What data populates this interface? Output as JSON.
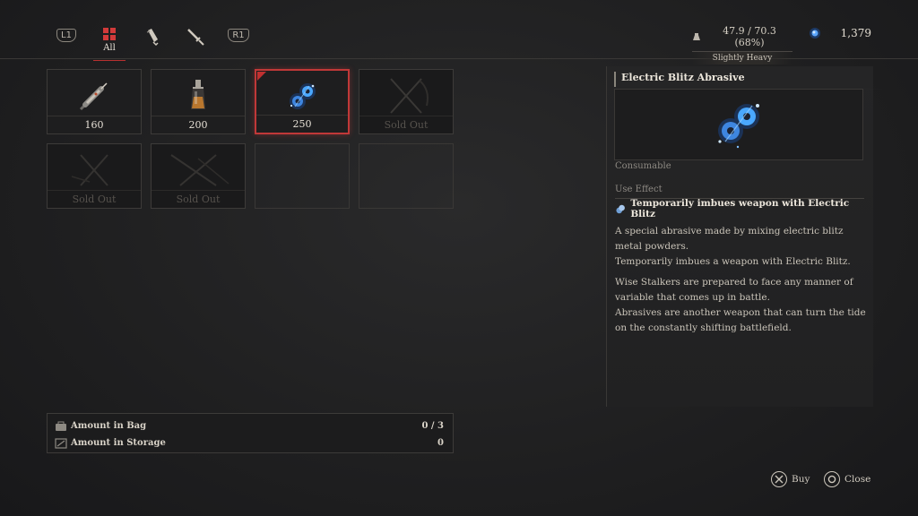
{
  "tabs": [
    {
      "kind": "shoulder",
      "label": "L1"
    },
    {
      "kind": "grid-icon",
      "label": "All",
      "active": true
    },
    {
      "kind": "consumable-icon",
      "label": ""
    },
    {
      "kind": "weapon-icon",
      "label": ""
    },
    {
      "kind": "shoulder",
      "label": "R1"
    }
  ],
  "weight": {
    "value": "47.9 / 70.3 (68%)",
    "status": "Slightly Heavy"
  },
  "currency": {
    "amount": "1,379"
  },
  "items": [
    {
      "price": "160",
      "sold_out": false,
      "selected": false,
      "icon": "syringe-icon"
    },
    {
      "price": "200",
      "sold_out": false,
      "selected": false,
      "icon": "flask-icon"
    },
    {
      "price": "250",
      "sold_out": false,
      "selected": true,
      "icon": "electric-blitz-abrasive-icon"
    },
    {
      "price": "Sold Out",
      "sold_out": true,
      "selected": false,
      "icon": "crossed-blades-icon"
    },
    {
      "price": "Sold Out",
      "sold_out": true,
      "selected": false,
      "icon": "crossed-blades-icon"
    },
    {
      "price": "Sold Out",
      "sold_out": true,
      "selected": false,
      "icon": "crossed-blades-icon"
    }
  ],
  "amounts": {
    "bag_label": "Amount in Bag",
    "bag_value": "0 / 3",
    "storage_label": "Amount in Storage",
    "storage_value": "0"
  },
  "detail": {
    "title": "Electric Blitz Abrasive",
    "category": "Consumable",
    "use_effect_label": "Use Effect",
    "effect": "Temporarily imbues weapon with Electric Blitz",
    "desc1": "A special abrasive made by mixing electric blitz metal powders.",
    "desc2": "Temporarily imbues a weapon with Electric Blitz.",
    "desc3": "Wise Stalkers are prepared to face any manner of variable that comes up in battle.",
    "desc4": "Abrasives are another weapon that can turn the tide on the constantly shifting battlefield."
  },
  "footer": {
    "buy_label": "Buy",
    "close_label": "Close"
  },
  "colors": {
    "accent_red": "#c03838",
    "electric_blue": "#4aa8ff"
  }
}
